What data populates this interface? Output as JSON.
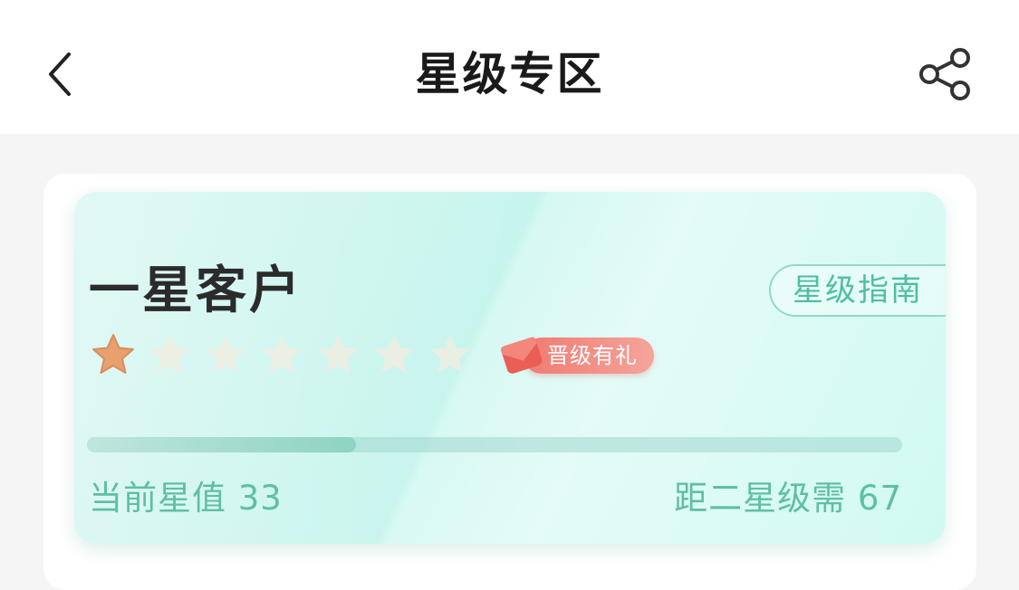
{
  "header": {
    "title": "星级专区",
    "back_icon": "chevron-left-icon",
    "share_icon": "share-icon"
  },
  "card": {
    "level_title": "一星客户",
    "guide_label": "星级指南",
    "stars_total": 7,
    "stars_earned": 1,
    "star_icon": "star-icon",
    "gift_badge_label": "晋级有礼",
    "gift_icon": "red-envelope-icon",
    "progress": 0.33,
    "current_value_text": "当前星值 33",
    "next_level_text": "距二星级需 67"
  },
  "colors": {
    "accent_text": "#5fbfa3",
    "star_earned": "#e8a06e",
    "star_empty": "#f0ede0",
    "badge": "#f07b72",
    "card_bg": "#c8f5ec"
  }
}
